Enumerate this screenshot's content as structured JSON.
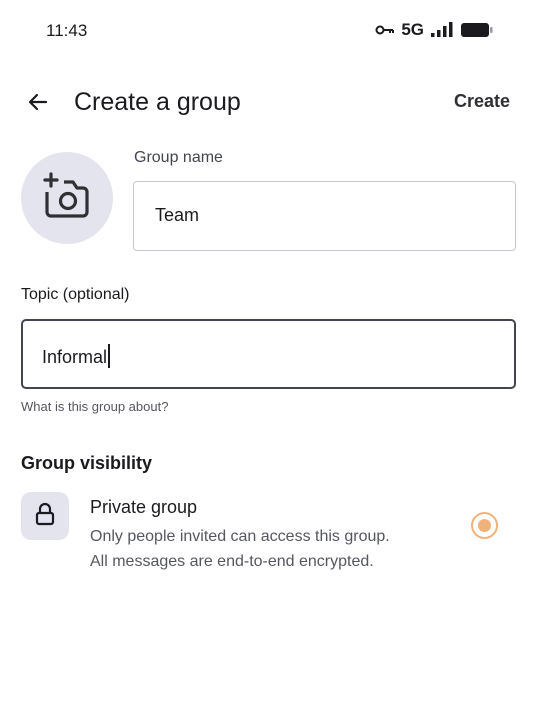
{
  "status_bar": {
    "time": "11:43",
    "network": "5G",
    "icons": [
      "vpn-key-icon",
      "signal-icon",
      "battery-icon"
    ]
  },
  "app_bar": {
    "title": "Create a group",
    "action_label": "Create",
    "back_icon": "back-arrow-icon"
  },
  "group_photo": {
    "icon": "add-photo-icon"
  },
  "group_name": {
    "label": "Group name",
    "value": "Team"
  },
  "topic": {
    "label": "Topic (optional)",
    "value": "Informal",
    "helper": "What is this group about?"
  },
  "visibility": {
    "heading": "Group visibility",
    "option": {
      "icon": "lock-icon",
      "title": "Private group",
      "description": "Only people invited can access this group. All messages are end-to-end encrypted.",
      "selected": true
    }
  },
  "colors": {
    "accent_radio": "#f0b279",
    "avatar_bg": "#e3e4ee",
    "field_border": "#c5c6d0",
    "focused_border": "#44464f"
  }
}
